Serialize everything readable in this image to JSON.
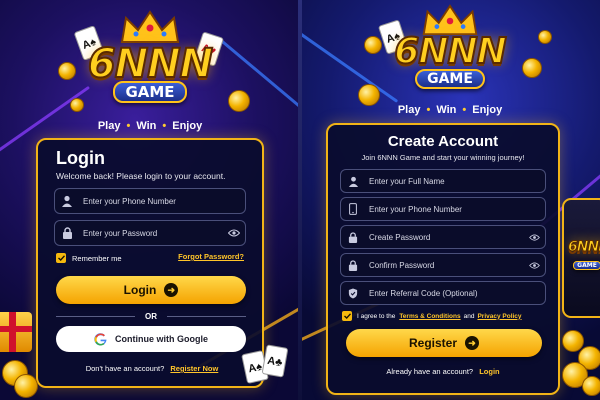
{
  "left": {
    "logo": {
      "main": "6NNN",
      "sub": "GAME"
    },
    "tagline": [
      "Play",
      "Win",
      "Enjoy"
    ],
    "form": {
      "title": "Login",
      "subtitle": "Welcome back! Please login to your account.",
      "phone_placeholder": "Enter your Phone Number",
      "password_placeholder": "Enter your Password",
      "remember_label": "Remember me",
      "forgot_label": "Forgot Password?",
      "login_button": "Login",
      "or_label": "OR",
      "google_button": "Continue with Google",
      "no_account_text": "Don't have an account?",
      "register_link": "Register Now"
    }
  },
  "right": {
    "logo": {
      "main": "6NNN",
      "sub": "GAME"
    },
    "tagline": [
      "Play",
      "Win",
      "Enjoy"
    ],
    "form": {
      "title": "Create Account",
      "subtitle": "Join 6NNN Game and start your winning journey!",
      "fullname_placeholder": "Enter your Full Name",
      "phone_placeholder": "Enter your Phone Number",
      "create_password_placeholder": "Create Password",
      "confirm_password_placeholder": "Confirm Password",
      "referral_placeholder": "Enter Referral Code (Optional)",
      "agree_text": "I agree to the",
      "terms_link": "Terms & Conditions",
      "and_text": "and",
      "privacy_link": "Privacy Policy",
      "register_button": "Register",
      "have_account_text": "Already have an account?",
      "login_link": "Login"
    },
    "phone_logo": {
      "main": "6NNN",
      "sub": "GAME"
    }
  },
  "colors": {
    "gold": "#f2b417",
    "accent": "#ffc52a",
    "field_bg": "#0a0c2a"
  },
  "icons": [
    "crown-icon",
    "user-icon",
    "lock-icon",
    "eye-icon",
    "phone-icon",
    "shield-icon",
    "check-icon",
    "arrow-right-icon",
    "google-icon"
  ]
}
